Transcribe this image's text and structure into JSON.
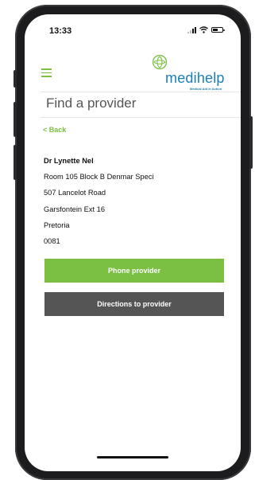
{
  "status_bar": {
    "time": "13:33"
  },
  "header": {
    "logo_text": "medihelp",
    "logo_tagline": "Medical Aid in Action"
  },
  "page": {
    "title": "Find a provider",
    "back_label": "< Back"
  },
  "provider": {
    "name": "Dr Lynette Nel",
    "address_lines": [
      "Room 105 Block B Denmar Speci",
      "507 Lancelot Road",
      "Garsfontein Ext 16",
      "Pretoria",
      "0081"
    ]
  },
  "actions": {
    "phone_label": "Phone provider",
    "directions_label": "Directions to provider"
  },
  "colors": {
    "accent_green": "#7bc043",
    "brand_blue": "#1a7fb8",
    "dark_button": "#555555"
  },
  "icons": [
    "menu-icon",
    "signal-icon",
    "wifi-icon",
    "battery-icon",
    "medihelp-logo-icon"
  ]
}
